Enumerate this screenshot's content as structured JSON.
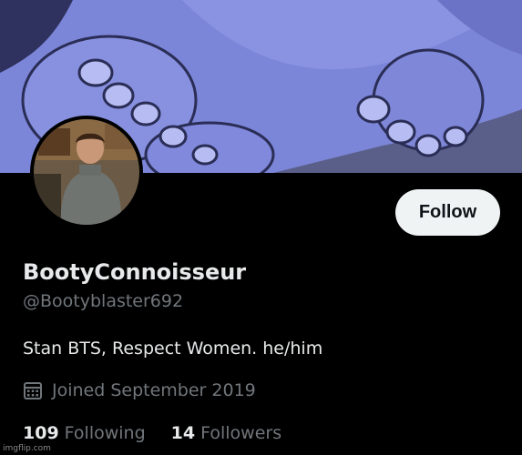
{
  "profile": {
    "display_name": "BootyConnoisseur",
    "handle": "@Bootyblaster692",
    "bio": "Stan BTS, Respect Women. he/him",
    "joined": "Joined September 2019"
  },
  "actions": {
    "follow_label": "Follow"
  },
  "stats": {
    "following_count": "109",
    "following_label": "Following",
    "followers_count": "14",
    "followers_label": "Followers"
  },
  "icons": {
    "calendar": "calendar-icon"
  },
  "colors": {
    "background": "#000000",
    "primary_text": "#e7e9ea",
    "secondary_text": "#71767b",
    "follow_button_bg": "#eff3f4",
    "banner_bg": "#7c86d9"
  },
  "watermark": "imgflip.com"
}
